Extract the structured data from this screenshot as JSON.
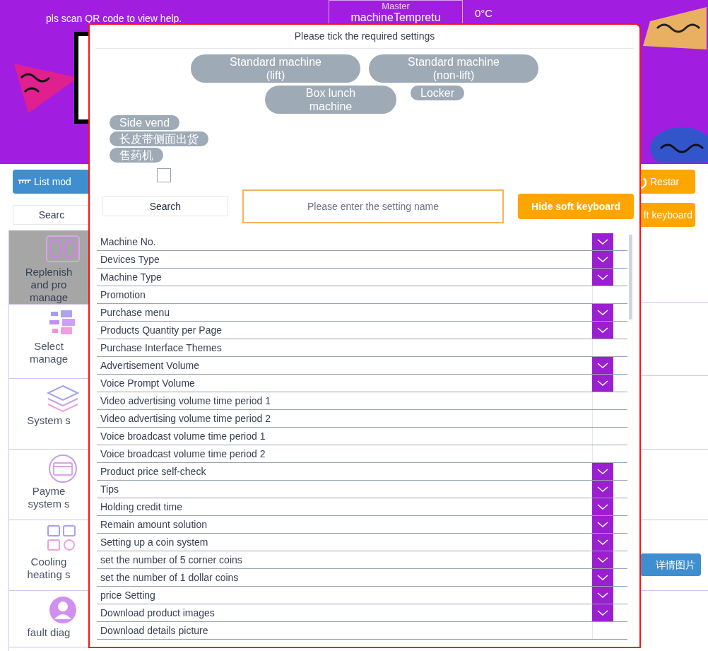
{
  "banner": {
    "help_text": "pls scan QR code to view help.",
    "temp_label_top": "Master",
    "temp_label": "machineTempretu",
    "temp_value": "0°C"
  },
  "toolbar": {
    "list_mode_button": "List mod",
    "restart_button": "Restar",
    "search_button": "Searc",
    "keyboard_button": "ft keyboard"
  },
  "sidebar": [
    {
      "label": "Replenish\nand pro\nmanage",
      "selected": true,
      "kind": "slots"
    },
    {
      "label": "Select\nmanage",
      "selected": false,
      "kind": "bars"
    },
    {
      "label": "System s",
      "selected": false,
      "kind": "layers"
    },
    {
      "label": "Payme\nsystem s",
      "selected": false,
      "kind": "card"
    },
    {
      "label": "Cooling\nheating s",
      "selected": false,
      "kind": "grid"
    },
    {
      "label": "fault diag",
      "selected": false,
      "kind": "person"
    }
  ],
  "detail_button": "详情图片",
  "dialog": {
    "title": "Please tick the required settings",
    "machine_types": [
      "Standard machine\n(lift)",
      "Standard machine\n(non-lift)",
      "Box lunch\nmachine",
      "Locker",
      "Side vend",
      "长皮带侧面出货",
      "售药机"
    ],
    "checkbox_checked": false,
    "search_label": "Search",
    "search_placeholder": "Please enter the setting name",
    "hide_keyboard_button": "Hide soft keyboard",
    "settings": [
      {
        "label": "Machine No.",
        "checked": true
      },
      {
        "label": "Devices Type",
        "checked": true
      },
      {
        "label": "Machine Type",
        "checked": true
      },
      {
        "label": "Promotion",
        "checked": false
      },
      {
        "label": "Purchase menu",
        "checked": true
      },
      {
        "label": "Products Quantity per Page",
        "checked": true
      },
      {
        "label": "Purchase Interface Themes",
        "checked": false
      },
      {
        "label": "Advertisement Volume",
        "checked": true
      },
      {
        "label": "Voice Prompt Volume",
        "checked": true
      },
      {
        "label": "Video advertising volume time period 1",
        "checked": false
      },
      {
        "label": "Video advertising volume time period 2",
        "checked": false
      },
      {
        "label": "Voice broadcast volume time period 1",
        "checked": false
      },
      {
        "label": "Voice broadcast volume time period 2",
        "checked": false
      },
      {
        "label": "Product price self-check",
        "checked": true
      },
      {
        "label": "Tips",
        "checked": true
      },
      {
        "label": "Holding credit time",
        "checked": true
      },
      {
        "label": "Remain amount solution",
        "checked": true
      },
      {
        "label": "Setting up a coin system",
        "checked": true
      },
      {
        "label": "set the number of 5 corner coins",
        "checked": true
      },
      {
        "label": "set the number of 1 dollar coins",
        "checked": true
      },
      {
        "label": "price Setting",
        "checked": true
      },
      {
        "label": "Download product images",
        "checked": true
      },
      {
        "label": "Download details picture",
        "checked": false
      }
    ]
  }
}
